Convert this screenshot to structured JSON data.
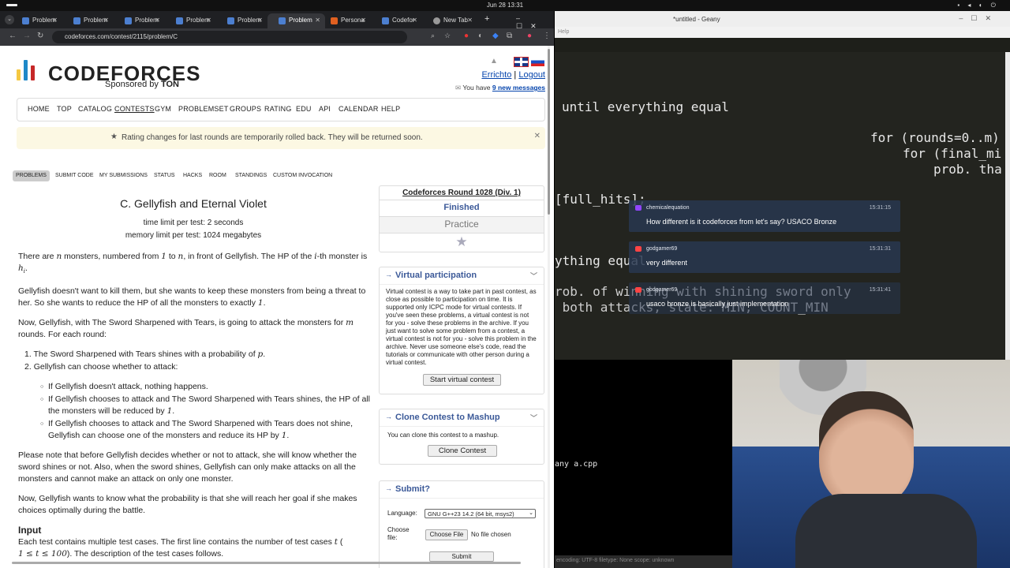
{
  "system": {
    "clock": "Jun 28  13:31"
  },
  "browser": {
    "tabs": [
      "Problem",
      "Problem",
      "Problem",
      "Problem",
      "Problem",
      "Problem",
      "Persona",
      "Codefor",
      "New Tab"
    ],
    "active_tab_index": 5,
    "url": "codeforces.com/contest/2115/problem/C"
  },
  "cf": {
    "logo_text": "CODEFORCES",
    "sponsor_prefix": "Sponsored by",
    "sponsor_name": "TON",
    "user": "Errichto",
    "logout": "Logout",
    "messages_prefix": "You have",
    "messages_link": "9 new messages",
    "menu": [
      "HOME",
      "TOP",
      "CATALOG",
      "CONTESTS",
      "GYM",
      "PROBLEMSET",
      "GROUPS",
      "RATING",
      "EDU",
      "API",
      "CALENDAR",
      "HELP"
    ],
    "notice": "Rating changes for last rounds are temporarily rolled back. They will be returned soon.",
    "subnav": [
      "PROBLEMS",
      "SUBMIT CODE",
      "MY SUBMISSIONS",
      "STATUS",
      "HACKS",
      "ROOM",
      "STANDINGS",
      "CUSTOM INVOCATION"
    ]
  },
  "problem": {
    "title": "C. Gellyfish and Eternal Violet",
    "time_limit": "time limit per test: 2 seconds",
    "memory_limit": "memory limit per test: 1024 megabytes",
    "p1a": "There are ",
    "p1b": " monsters, numbered from ",
    "p1c": " to ",
    "p1d": ", in front of Gellyfish. The HP of the ",
    "p1e": "-th monster is ",
    "p2": "Gellyfish doesn't want to kill them, but she wants to keep these monsters from being a threat to her. So she wants to reduce the HP of all the monsters to exactly ",
    "p3a": "Now, Gellyfish, with The Sword Sharpened with Tears, is going to attack the monsters for ",
    "p3b": " rounds. For each round:",
    "li1": "The Sword Sharpened with Tears shines with a probability of ",
    "li2": "Gellyfish can choose whether to attack:",
    "sub1": "If Gellyfish doesn't attack, nothing happens.",
    "sub2": "If Gellyfish chooses to attack and The Sword Sharpened with Tears shines, the HP of all the monsters will be reduced by ",
    "sub3": "If Gellyfish chooses to attack and The Sword Sharpened with Tears does not shine, Gellyfish can choose one of the monsters and reduce its HP by ",
    "p4": "Please note that before Gellyfish decides whether or not to attack, she will know whether the sword shines or not. Also, when the sword shines, Gellyfish can only make attacks on all the monsters and cannot make an attack on only one monster.",
    "p5": "Now, Gellyfish wants to know what the probability is that she will reach her goal if she makes choices optimally during the battle.",
    "input_heading": "Input",
    "input1": "Each test contains multiple test cases. The first line contains the number of test cases ",
    "input2": "). The description of the test cases follows.",
    "math": {
      "n": "n",
      "one": "1",
      "i": "i",
      "h": "h",
      "hi_sub": "i",
      "m": "m",
      "p": "p",
      "t": "t",
      "range": "1 ≤ t ≤ 100",
      "paren": "("
    }
  },
  "sidebar": {
    "contest_name": "Codeforces Round 1028 (Div. 1)",
    "status": "Finished",
    "mode": "Practice",
    "virtual_title": "Virtual participation",
    "virtual_text": "Virtual contest is a way to take part in past contest, as close as possible to participation on time. It is supported only ICPC mode for virtual contests. If you've seen these problems, a virtual contest is not for you - solve these problems in the archive. If you just want to solve some problem from a contest, a virtual contest is not for you - solve this problem in the archive. Never use someone else's code, read the tutorials or communicate with other person during a virtual contest.",
    "virtual_button": "Start virtual contest",
    "clone_title": "Clone Contest to Mashup",
    "clone_text": "You can clone this contest to a mashup.",
    "clone_button": "Clone Contest",
    "submit_title": "Submit?",
    "language_label": "Language:",
    "language_value": "GNU G++23 14.2 (64 bit, msys2)",
    "file_label": "Choose file:",
    "file_button": "Choose File",
    "file_status": "No file chosen",
    "submit_button": "Submit"
  },
  "editor": {
    "title": "*untitled - Geany",
    "menu_help": "Help",
    "code_lines": [
      "until everything equal",
      "for (rounds=0..m)",
      "for (final_mi",
      "prob. tha",
      "[full_hits];",
      "ything equal",
      "rob. of winning with shining sword only",
      " both attacks, state: MIN, COUNT_MIN"
    ],
    "terminal": "any a.cpp",
    "status": "encoding: UTF-8    filetype: None    scope: unknown"
  },
  "chat": [
    {
      "user": "chemicalequation",
      "time": "15:31:15",
      "text": "How different is it codeforces from let's say? USACO Bronze",
      "color": "#9146ff"
    },
    {
      "user": "godgamer69",
      "time": "15:31:31",
      "text": "very different",
      "color": "#ff4444"
    },
    {
      "user": "godgamer69",
      "time": "15:31:41",
      "text": "usaco bronze is basically just implementation",
      "color": "#ff4444"
    }
  ]
}
